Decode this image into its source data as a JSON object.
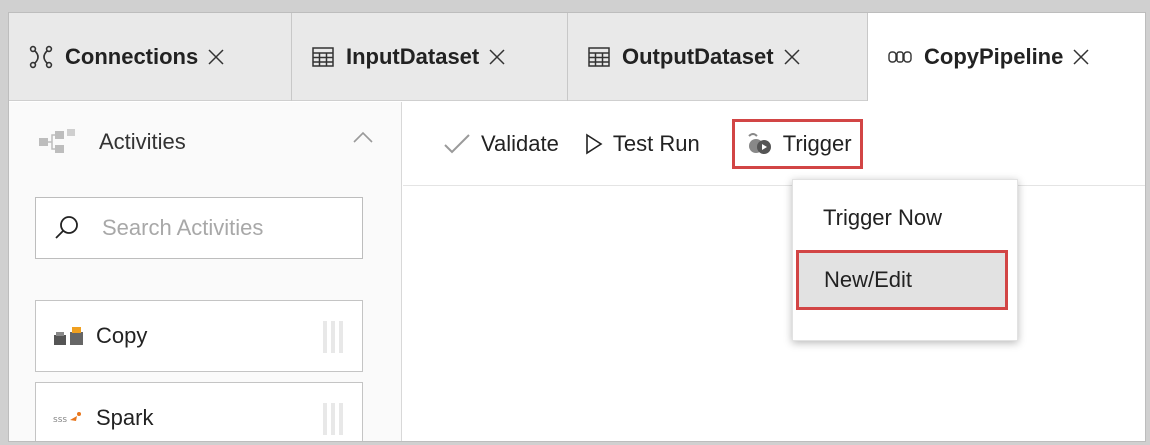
{
  "tabs": [
    {
      "label": "Connections",
      "icon": "connections-icon"
    },
    {
      "label": "InputDataset",
      "icon": "table-icon"
    },
    {
      "label": "OutputDataset",
      "icon": "table-icon"
    },
    {
      "label": "CopyPipeline",
      "icon": "pipeline-icon"
    }
  ],
  "activities": {
    "title": "Activities",
    "search_placeholder": "Search Activities",
    "items": [
      {
        "label": "Copy",
        "icon": "copy-activity-icon"
      },
      {
        "label": "Spark",
        "icon": "spark-activity-icon"
      }
    ]
  },
  "toolbar": {
    "validate_label": "Validate",
    "test_run_label": "Test Run",
    "trigger_label": "Trigger"
  },
  "trigger_menu": {
    "items": [
      "Trigger Now",
      "New/Edit"
    ],
    "highlighted": "New/Edit"
  },
  "colors": {
    "highlight_border": "#d24545",
    "tabbar_bg": "#e9e9e9",
    "menu_hover_bg": "#e2e2e2"
  }
}
